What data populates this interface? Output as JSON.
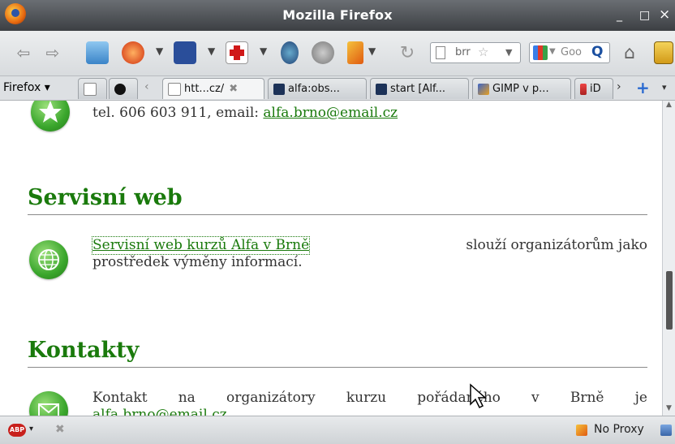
{
  "window": {
    "title": "Mozilla Firefox",
    "minimize": "_",
    "maximize": "□",
    "close": "×"
  },
  "navbar": {
    "url_text": "brr",
    "search_placeholder": "Goo"
  },
  "tabs": {
    "firefox_menu": "Firefox",
    "items": [
      {
        "label": "htt...cz/"
      },
      {
        "label": "alfa:obs..."
      },
      {
        "label": "start [Alf..."
      },
      {
        "label": "GIMP v p..."
      },
      {
        "label": "iD"
      }
    ]
  },
  "page": {
    "contact_top": {
      "prefix": "tel. 606 603 911, email: ",
      "email": "alfa.brno@email.cz"
    },
    "servis": {
      "heading": "Servisní web",
      "link": "Servisní web kurzů Alfa v Brně",
      "rest1": " slouží organizátorům jako",
      "line2": "prostředek výměny informací."
    },
    "kontakty": {
      "heading": "Kontakty",
      "line1": "Kontakt na organizátory kurzu pořádaného v Brně je",
      "line2": "alfa.brno@email.cz"
    }
  },
  "status": {
    "proxy": "No Proxy",
    "adblock": "ABP"
  },
  "colors": {
    "heading": "#1a7a0c",
    "link": "#1a7a0c"
  }
}
